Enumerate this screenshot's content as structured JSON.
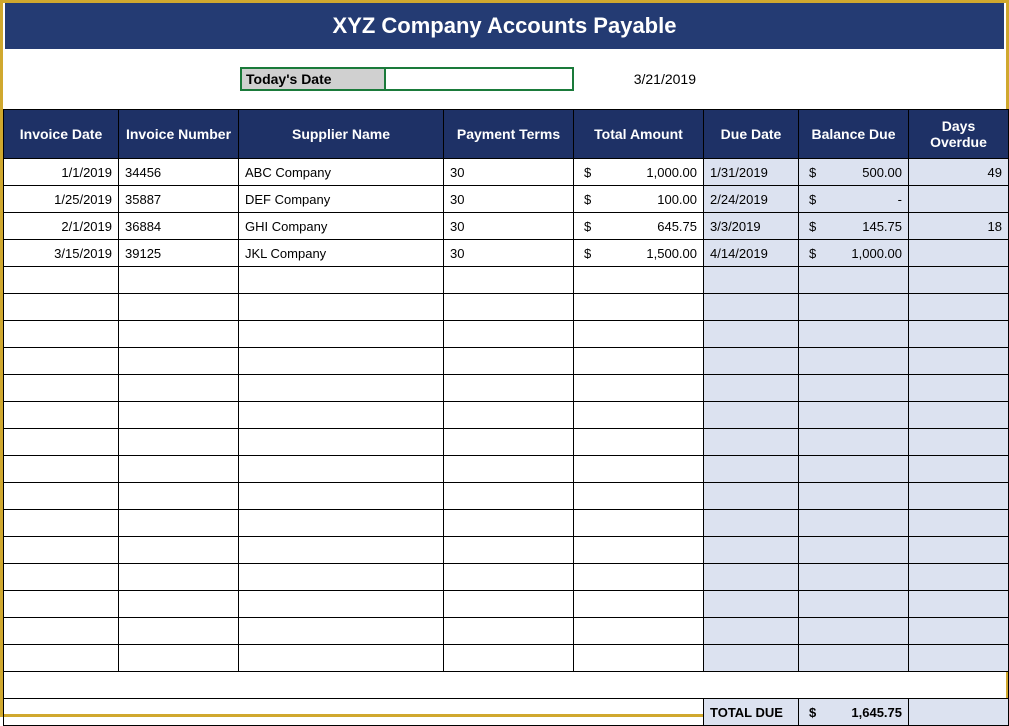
{
  "title": "XYZ Company Accounts Payable",
  "dateLabel": "Today's Date",
  "dateValue": "3/21/2019",
  "columns": {
    "invoiceDate": "Invoice Date",
    "invoiceNumber": "Invoice Number",
    "supplierName": "Supplier Name",
    "paymentTerms": "Payment Terms",
    "totalAmount": "Total Amount",
    "dueDate": "Due Date",
    "balanceDue": "Balance Due",
    "daysOverdue": "Days Overdue"
  },
  "currency": "$",
  "rows": [
    {
      "invoiceDate": "1/1/2019",
      "invoiceNumber": "34456",
      "supplier": "ABC Company",
      "terms": "30",
      "totalAmount": "1,000.00",
      "dueDate": "1/31/2019",
      "balanceDue": "500.00",
      "daysOverdue": "49"
    },
    {
      "invoiceDate": "1/25/2019",
      "invoiceNumber": "35887",
      "supplier": "DEF Company",
      "terms": "30",
      "totalAmount": "100.00",
      "dueDate": "2/24/2019",
      "balanceDue": "-",
      "daysOverdue": ""
    },
    {
      "invoiceDate": "2/1/2019",
      "invoiceNumber": "36884",
      "supplier": "GHI Company",
      "terms": "30",
      "totalAmount": "645.75",
      "dueDate": "3/3/2019",
      "balanceDue": "145.75",
      "daysOverdue": "18"
    },
    {
      "invoiceDate": "3/15/2019",
      "invoiceNumber": "39125",
      "supplier": "JKL Company",
      "terms": "30",
      "totalAmount": "1,500.00",
      "dueDate": "4/14/2019",
      "balanceDue": "1,000.00",
      "daysOverdue": ""
    },
    {
      "invoiceDate": "",
      "invoiceNumber": "",
      "supplier": "",
      "terms": "",
      "totalAmount": "",
      "dueDate": "",
      "balanceDue": "",
      "daysOverdue": ""
    },
    {
      "invoiceDate": "",
      "invoiceNumber": "",
      "supplier": "",
      "terms": "",
      "totalAmount": "",
      "dueDate": "",
      "balanceDue": "",
      "daysOverdue": ""
    },
    {
      "invoiceDate": "",
      "invoiceNumber": "",
      "supplier": "",
      "terms": "",
      "totalAmount": "",
      "dueDate": "",
      "balanceDue": "",
      "daysOverdue": ""
    },
    {
      "invoiceDate": "",
      "invoiceNumber": "",
      "supplier": "",
      "terms": "",
      "totalAmount": "",
      "dueDate": "",
      "balanceDue": "",
      "daysOverdue": ""
    },
    {
      "invoiceDate": "",
      "invoiceNumber": "",
      "supplier": "",
      "terms": "",
      "totalAmount": "",
      "dueDate": "",
      "balanceDue": "",
      "daysOverdue": ""
    },
    {
      "invoiceDate": "",
      "invoiceNumber": "",
      "supplier": "",
      "terms": "",
      "totalAmount": "",
      "dueDate": "",
      "balanceDue": "",
      "daysOverdue": ""
    },
    {
      "invoiceDate": "",
      "invoiceNumber": "",
      "supplier": "",
      "terms": "",
      "totalAmount": "",
      "dueDate": "",
      "balanceDue": "",
      "daysOverdue": ""
    },
    {
      "invoiceDate": "",
      "invoiceNumber": "",
      "supplier": "",
      "terms": "",
      "totalAmount": "",
      "dueDate": "",
      "balanceDue": "",
      "daysOverdue": ""
    },
    {
      "invoiceDate": "",
      "invoiceNumber": "",
      "supplier": "",
      "terms": "",
      "totalAmount": "",
      "dueDate": "",
      "balanceDue": "",
      "daysOverdue": ""
    },
    {
      "invoiceDate": "",
      "invoiceNumber": "",
      "supplier": "",
      "terms": "",
      "totalAmount": "",
      "dueDate": "",
      "balanceDue": "",
      "daysOverdue": ""
    },
    {
      "invoiceDate": "",
      "invoiceNumber": "",
      "supplier": "",
      "terms": "",
      "totalAmount": "",
      "dueDate": "",
      "balanceDue": "",
      "daysOverdue": ""
    },
    {
      "invoiceDate": "",
      "invoiceNumber": "",
      "supplier": "",
      "terms": "",
      "totalAmount": "",
      "dueDate": "",
      "balanceDue": "",
      "daysOverdue": ""
    },
    {
      "invoiceDate": "",
      "invoiceNumber": "",
      "supplier": "",
      "terms": "",
      "totalAmount": "",
      "dueDate": "",
      "balanceDue": "",
      "daysOverdue": ""
    },
    {
      "invoiceDate": "",
      "invoiceNumber": "",
      "supplier": "",
      "terms": "",
      "totalAmount": "",
      "dueDate": "",
      "balanceDue": "",
      "daysOverdue": ""
    },
    {
      "invoiceDate": "",
      "invoiceNumber": "",
      "supplier": "",
      "terms": "",
      "totalAmount": "",
      "dueDate": "",
      "balanceDue": "",
      "daysOverdue": ""
    }
  ],
  "totalLabel": "TOTAL DUE",
  "totalDue": "1,645.75"
}
